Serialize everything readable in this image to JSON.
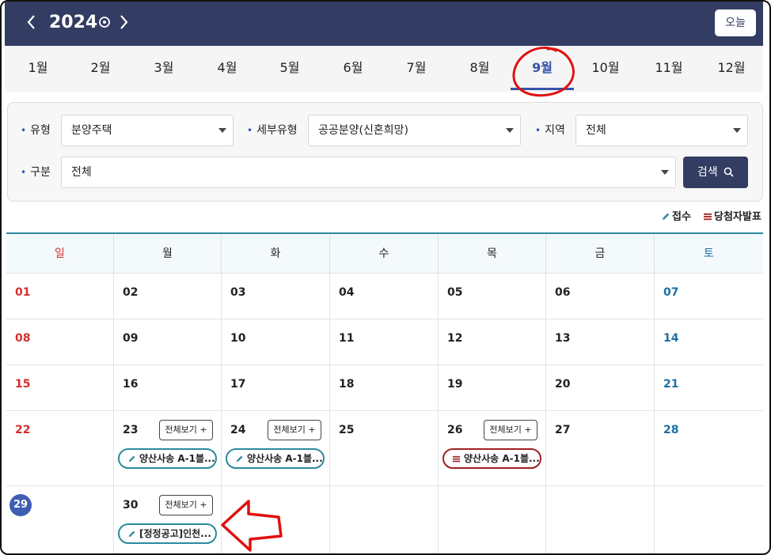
{
  "header": {
    "prev_icon": "chevron-left-icon",
    "year": "2024",
    "year_picker_icon": "circle-dot-icon",
    "next_icon": "chevron-right-icon",
    "today_label": "오늘"
  },
  "months": [
    "1월",
    "2월",
    "3월",
    "4월",
    "5월",
    "6월",
    "7월",
    "8월",
    "9월",
    "10월",
    "11월",
    "12월"
  ],
  "active_month": "9월",
  "filters": {
    "type_label": "유형",
    "type_value": "분양주택",
    "subtype_label": "세부유형",
    "subtype_value": "공공분양(신혼희망)",
    "region_label": "지역",
    "region_value": "전체",
    "category_label": "구분",
    "category_value": "전체",
    "search_label": "검색"
  },
  "legend": {
    "receipt": "접수",
    "winner": "당첨자발표"
  },
  "calendar": {
    "weekdays": [
      "일",
      "월",
      "화",
      "수",
      "목",
      "금",
      "토"
    ],
    "view_all_label": "전체보기 +",
    "weeks": [
      [
        "01",
        "02",
        "03",
        "04",
        "05",
        "06",
        "07"
      ],
      [
        "08",
        "09",
        "10",
        "11",
        "12",
        "13",
        "14"
      ],
      [
        "15",
        "16",
        "17",
        "18",
        "19",
        "20",
        "21"
      ],
      [
        "22",
        "23",
        "24",
        "25",
        "26",
        "27",
        "28"
      ],
      [
        "29",
        "30",
        "",
        "",
        "",
        "",
        ""
      ]
    ],
    "today": "29",
    "events": {
      "23": "양산사송 A-1블...",
      "24": "양산사송 A-1블...",
      "26": "양산사송 A-1블...",
      "30": "[정정공고]인천..."
    }
  },
  "colors": {
    "header_bg": "#333d63",
    "accent_blue": "#3653a8",
    "sunday_red": "#d32f2f",
    "saturday_blue": "#1d6fa5",
    "receipt_teal": "#2b8a9e",
    "winner_red": "#a02020",
    "annotation_red": "#e01010"
  }
}
